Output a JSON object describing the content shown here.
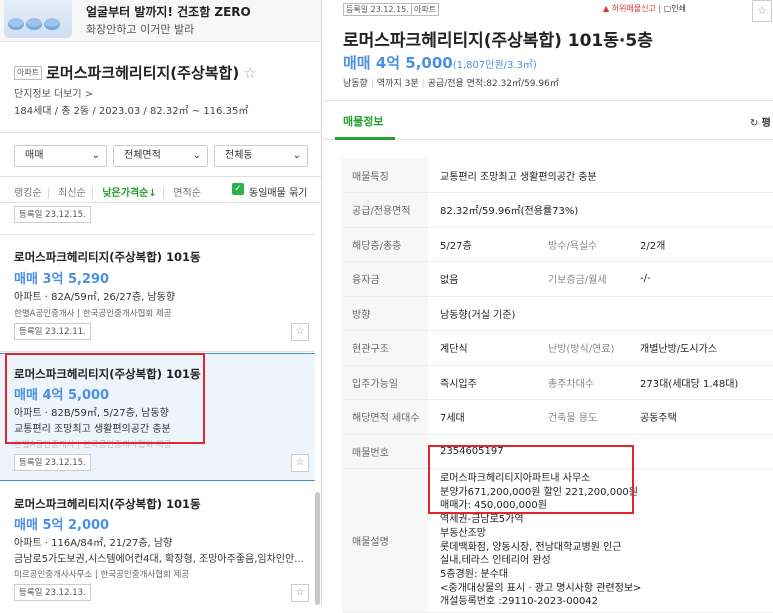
{
  "ad": {
    "line1": "얼굴부터 발까지! 건조함 ZERO",
    "line2": "화장안하고 이거만 발라"
  },
  "complex": {
    "type_tag": "아파트",
    "name": "로머스파크헤리티지(주상복합)",
    "more": "단지정보 더보기 >",
    "info": "184세대 / 총 2동 / 2023.03 / 82.32㎡ ~ 116.35㎡"
  },
  "filters": {
    "trade": "매매",
    "area": "전체면적",
    "dong": "전체동"
  },
  "sort": {
    "items": [
      "랭킹순",
      "최신순",
      "낮은가격순↓",
      "면적순"
    ],
    "active_index": 2,
    "same_listing": "동일매물 묶기"
  },
  "icons": {
    "star": "star-icon",
    "chevron": "chevron-down-icon",
    "check": "check-icon",
    "refresh": "refresh-icon",
    "siren": "siren-icon",
    "print": "print-icon"
  },
  "listings": [
    {
      "date": "등록일 23.12.15."
    },
    {
      "title": "로머스파크헤리티지(주상복합) 101동",
      "price": "매매 3억 5,290",
      "desc": "아파트 · 82A/59㎡, 26/27층, 남동향",
      "agent": "한별A공인중개사 | 한국공인중개사협회 제공",
      "date": "등록일 23.12.11."
    },
    {
      "title": "로머스파크헤리티지(주상복합) 101동",
      "price": "매매 4억 5,000",
      "desc": "아파트 · 82B/59㎡, 5/27층, 남동향",
      "feature": "교통편리 조망최고 생활편의공간 충분",
      "agent": "한별A공인중개사 | 한국공인중개사협회 제공",
      "date": "등록일 23.12.15."
    },
    {
      "title": "로머스파크헤리티지(주상복합) 101동",
      "price": "매매 5억 2,000",
      "desc": "아파트 · 116A/84㎡, 21/27층, 남향",
      "feature": "금남로5가도보권,시스템에어컨4대, 확장형, 조망아주좋음,임차인안...",
      "agent": "미르공인중개사사무소 | 한국공인중개사협회 제공",
      "date": "등록일 23.12.13."
    }
  ],
  "detail": {
    "date_tag": "등록일 23.12.15.",
    "type_tag": "아파트",
    "report": "허위매물신고",
    "print": "인쇄",
    "title": "로머스파크헤리티지(주상복합) 101동·5층",
    "price": "매매 4억 5,000",
    "price_per": "(1,807만원/3.3㎡)",
    "sub": [
      "남동향",
      "역까지 3분",
      "공급/전용 면적:82.32㎡/59.96㎡"
    ],
    "tab": "매물정보",
    "refresh": "평",
    "rows": {
      "feature_k": "매물특징",
      "feature_v": "교통편리 조망최고 생활편의공간 충분",
      "area_k": "공급/전용면적",
      "area_v": "82.32㎡/59.96㎡(전용률73%)",
      "floor_k": "해당층/총층",
      "floor_v": "5/27층",
      "rooms_k": "방수/욕실수",
      "rooms_v": "2/2개",
      "loan_k": "융자금",
      "loan_v": "없음",
      "deposit_k": "기보증금/월세",
      "deposit_v": "-/-",
      "dir_k": "방향",
      "dir_v": "남동향(거실 기준)",
      "entr_k": "현관구조",
      "entr_v": "계단식",
      "heat_k": "난방(방식/연료)",
      "heat_v": "개별난방/도시가스",
      "move_k": "입주가능일",
      "move_v": "즉시입주",
      "park_k": "총주차대수",
      "park_v": "273대(세대당 1.48대)",
      "units_k": "해당면적 세대수",
      "units_v": "7세대",
      "use_k": "건축물 용도",
      "use_v": "공동주택",
      "no_k": "매물번호",
      "no_v": "2354605197",
      "desc_k": "매물설명",
      "desc_lines": [
        "로머스파크헤리티지아파트내 사무소",
        "분양가671,200,000원 할인 221,200,000원",
        "매매가: 450,000,000원",
        "역세권-금남로5가역",
        "부동산조망",
        "롯데백화점, 양동시장, 전남대학교병원 인근",
        "실내,테라스 인테리어 완성",
        "5층경원: 분수대",
        "<중개대상물의 표시 · 광고 명시사항 관련정보>",
        "개설등록번호 :29110-2023-00042"
      ]
    }
  }
}
